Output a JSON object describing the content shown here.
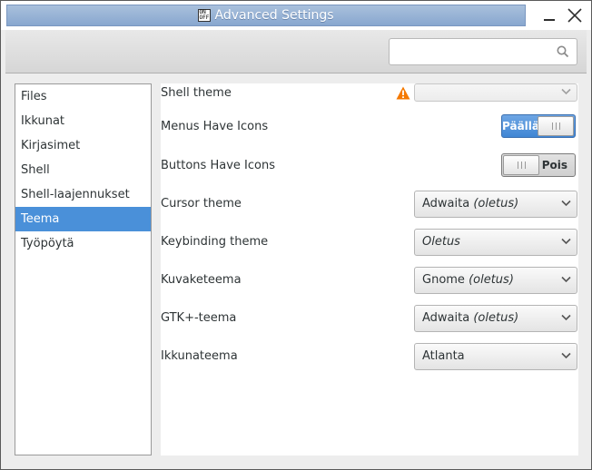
{
  "window": {
    "title": "Advanced Settings",
    "icon": "settings-app-icon",
    "app_icon_text": "ON OFF"
  },
  "header": {
    "search": {
      "value": "",
      "placeholder": "",
      "icon": "search-icon"
    }
  },
  "sidebar": {
    "items": [
      {
        "label": "Files",
        "selected": false
      },
      {
        "label": "Ikkunat",
        "selected": false
      },
      {
        "label": "Kirjasimet",
        "selected": false
      },
      {
        "label": "Shell",
        "selected": false
      },
      {
        "label": "Shell-laajennukset",
        "selected": false
      },
      {
        "label": "Teema",
        "selected": true
      },
      {
        "label": "Työpöytä",
        "selected": false
      }
    ]
  },
  "settings": {
    "shell_theme": {
      "label": "Shell theme",
      "value": "",
      "warning_icon": "warning-icon"
    },
    "menus_have_icons": {
      "label": "Menus Have Icons",
      "state_label": "Päällä",
      "on": true
    },
    "buttons_have_icons": {
      "label": "Buttons Have Icons",
      "state_label": "Pois",
      "on": false
    },
    "cursor_theme": {
      "label": "Cursor theme",
      "value_name": "Adwaita",
      "value_suffix": "(oletus)"
    },
    "keybinding_theme": {
      "label": "Keybinding theme",
      "value_name": "",
      "value_suffix": "Oletus"
    },
    "icon_theme": {
      "label": "Kuvaketeema",
      "value_name": "Gnome",
      "value_suffix": "(oletus)"
    },
    "gtk_theme": {
      "label": "GTK+-teema",
      "value_name": "Adwaita",
      "value_suffix": "(oletus)"
    },
    "window_theme": {
      "label": "Ikkunateema",
      "value_name": "Atlanta",
      "value_suffix": ""
    }
  },
  "colors": {
    "selection": "#4a90d9",
    "switch_on": "#3f86d4",
    "warning": "#f57900"
  }
}
